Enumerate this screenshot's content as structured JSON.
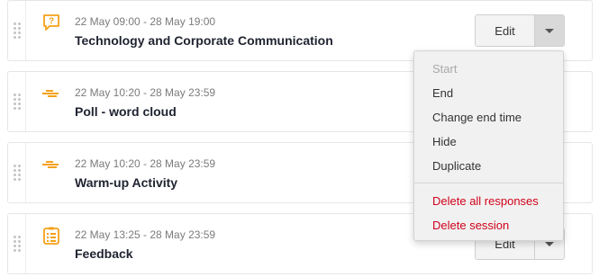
{
  "sessions": [
    {
      "time": "22 May 09:00 - 28 May 19:00",
      "title": "Technology and Corporate Communication",
      "icon": "question-bubble-icon"
    },
    {
      "time": "22 May 10:20 - 28 May 23:59",
      "title": "Poll - word cloud",
      "icon": "word-cloud-icon"
    },
    {
      "time": "22 May 10:20 - 28 May 23:59",
      "title": "Warm-up Activity",
      "icon": "word-cloud-icon"
    },
    {
      "time": "22 May 13:25 - 28 May 23:59",
      "title": "Feedback",
      "icon": "survey-list-icon"
    }
  ],
  "edit_label": "Edit",
  "menu": {
    "items": [
      "Start",
      "End",
      "Change end time",
      "Hide",
      "Duplicate"
    ],
    "danger_items": [
      "Delete all responses",
      "Delete session"
    ]
  },
  "colors": {
    "accent": "#f5a11a",
    "danger": "#d0021b"
  }
}
